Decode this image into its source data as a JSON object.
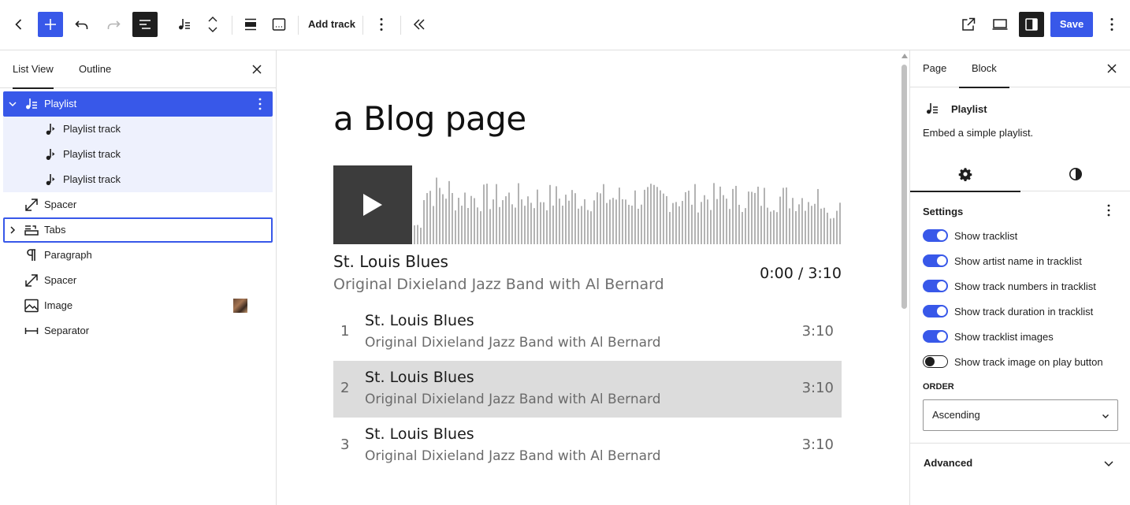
{
  "toolbar": {
    "add_track_label": "Add track",
    "save_label": "Save",
    "accent": "#3858e9"
  },
  "left_panel": {
    "tabs": [
      {
        "label": "List View",
        "active": true
      },
      {
        "label": "Outline",
        "active": false
      }
    ],
    "items": [
      {
        "label": "Playlist",
        "icon": "playlist-icon",
        "selected": true,
        "expanded": true
      },
      {
        "label": "Playlist track",
        "icon": "music-note-icon"
      },
      {
        "label": "Playlist track",
        "icon": "music-note-icon"
      },
      {
        "label": "Playlist track",
        "icon": "music-note-icon"
      },
      {
        "label": "Spacer",
        "icon": "resize-icon"
      },
      {
        "label": "Tabs",
        "icon": "tabs-icon",
        "expanded": false
      },
      {
        "label": "Paragraph",
        "icon": "pilcrow-icon"
      },
      {
        "label": "Spacer",
        "icon": "resize-icon"
      },
      {
        "label": "Image",
        "icon": "image-icon"
      },
      {
        "label": "Separator",
        "icon": "separator-icon"
      }
    ]
  },
  "canvas": {
    "page_title": "a Blog page",
    "now_playing": {
      "title": "St. Louis Blues",
      "artist": "Original Dixieland Jazz Band with Al Bernard",
      "time": "0:00 / 3:10"
    },
    "tracks": [
      {
        "num": "1",
        "title": "St. Louis Blues",
        "artist": "Original Dixieland Jazz Band with Al Bernard",
        "duration": "3:10",
        "highlighted": false
      },
      {
        "num": "2",
        "title": "St. Louis Blues",
        "artist": "Original Dixieland Jazz Band with Al Bernard",
        "duration": "3:10",
        "highlighted": true
      },
      {
        "num": "3",
        "title": "St. Louis Blues",
        "artist": "Original Dixieland Jazz Band with Al Bernard",
        "duration": "3:10",
        "highlighted": false
      }
    ]
  },
  "right_panel": {
    "tabs": [
      {
        "label": "Page",
        "active": false
      },
      {
        "label": "Block",
        "active": true
      }
    ],
    "block": {
      "title": "Playlist",
      "description": "Embed a simple playlist."
    },
    "settings_heading": "Settings",
    "toggles": [
      {
        "label": "Show tracklist",
        "on": true
      },
      {
        "label": "Show artist name in tracklist",
        "on": true
      },
      {
        "label": "Show track numbers in tracklist",
        "on": true
      },
      {
        "label": "Show track duration in tracklist",
        "on": true
      },
      {
        "label": "Show tracklist images",
        "on": true
      },
      {
        "label": "Show track image on play button",
        "on": false
      }
    ],
    "order_label": "ORDER",
    "order_value": "Ascending",
    "advanced_label": "Advanced"
  }
}
